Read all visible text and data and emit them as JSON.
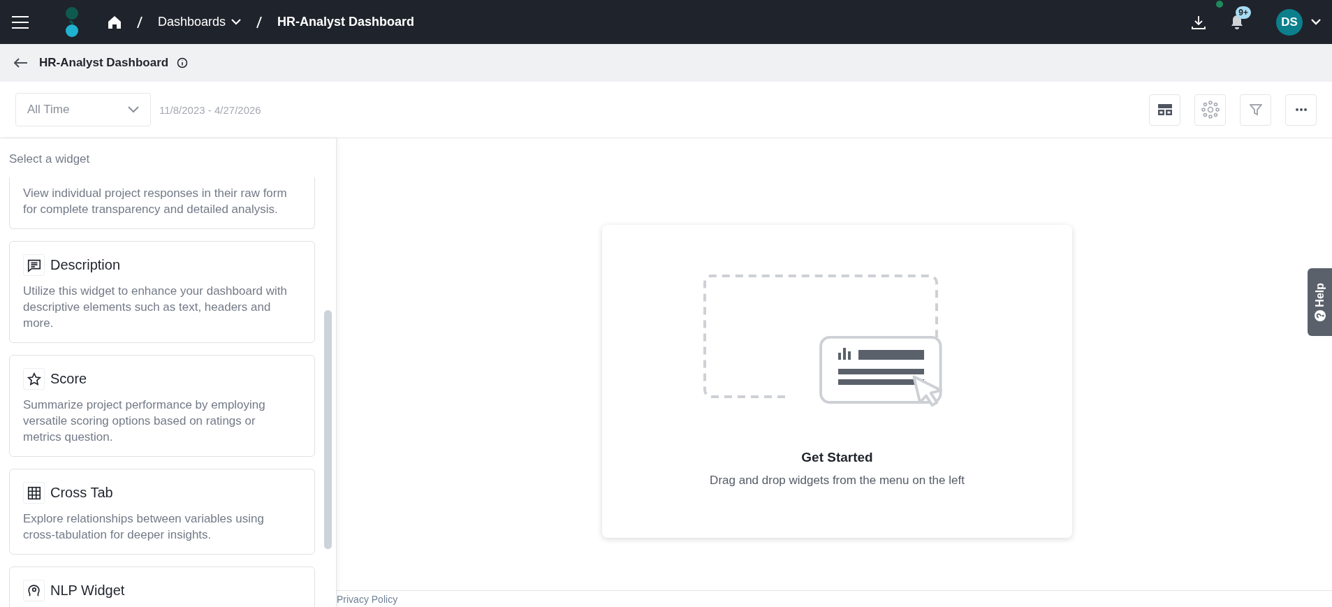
{
  "topbar": {
    "breadcrumbs": [
      {
        "label": "Dashboards",
        "kind": "dropdown"
      },
      {
        "label": "HR-Analyst Dashboard",
        "kind": "current"
      }
    ],
    "notifications": {
      "badge": "9+"
    },
    "avatar": {
      "initials": "DS"
    }
  },
  "subheader": {
    "title": "HR-Analyst Dashboard"
  },
  "toolbar": {
    "date_range": {
      "value": "All Time"
    },
    "dates": "11/8/2023 - 4/27/2026"
  },
  "sidebar": {
    "title": "Select a widget",
    "widgets": [
      {
        "kind": "raw",
        "description": "View individual project responses in their raw form for complete transparency and detailed analysis."
      },
      {
        "kind": "description",
        "title": "Description",
        "description": "Utilize this widget to enhance your dashboard with descriptive elements such as text, headers and more."
      },
      {
        "kind": "score",
        "title": "Score",
        "description": "Summarize project performance by employing versatile scoring options based on ratings or metrics question."
      },
      {
        "kind": "crosstab",
        "title": "Cross Tab",
        "description": "Explore relationships between variables using cross-tabulation for deeper insights."
      },
      {
        "kind": "nlp",
        "title": "NLP Widget"
      }
    ]
  },
  "empty_state": {
    "title": "Get Started",
    "text": "Drag and drop widgets from the menu on the left"
  },
  "help_tab": {
    "label": "Help"
  },
  "footer": {
    "link": "Privacy Policy"
  }
}
